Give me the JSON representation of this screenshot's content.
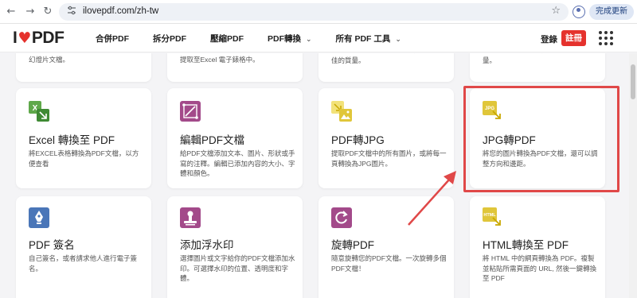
{
  "browser": {
    "url": "ilovepdf.com/zh-tw",
    "update_label": "完成更新",
    "icons": [
      "back-icon",
      "forward-icon",
      "reload-icon",
      "site-settings-icon",
      "bookmark-star-icon",
      "profile-icon"
    ]
  },
  "header": {
    "logo_left": "I",
    "logo_right": "PDF",
    "nav": [
      "合併PDF",
      "拆分PDF",
      "壓縮PDF",
      "PDF轉換",
      "所有 PDF 工具"
    ],
    "login": "登錄",
    "signup": "註冊",
    "brand_color": "#e5322d"
  },
  "cards_top": [
    "幻燈片文檔。",
    "提取至Excel 電子錶格中。",
    "DOC或DOCX文檔完全一樣，並保持最佳的質量。",
    "PPTX文檔完全一樣，並保持最佳的質量。"
  ],
  "cards": [
    {
      "title": "Excel 轉換至 PDF",
      "desc": "將EXCEL表格轉換為PDF文檔，以方便查看",
      "icon": "excel-to-pdf-icon",
      "color": "#5fa84a"
    },
    {
      "title": "編輯PDF文檔",
      "desc": "給PDF文檔添加文本、圖片、形狀或手寫的注釋。編輯已添加內容的大小、字體和顏色。",
      "icon": "edit-pdf-icon",
      "color": "#a34a8a"
    },
    {
      "title": "PDF轉JPG",
      "desc": "提取PDF文檔中的所有圖片，或將每一頁轉換為JPG圖片。",
      "icon": "pdf-to-jpg-icon",
      "color": "#e0c63a"
    },
    {
      "title": "JPG轉PDF",
      "desc": "將您的圖片轉換為PDF文檔，還可以調整方向和邊距。",
      "icon": "jpg-to-pdf-icon",
      "color": "#e0c63a"
    },
    {
      "title": "PDF 簽名",
      "desc": "自己簽名，或者請求他人進行電子簽名。",
      "icon": "sign-pdf-icon",
      "color": "#4a76b8"
    },
    {
      "title": "添加浮水印",
      "desc": "選擇圖片或文字給你的PDF文檔添加水印。可選擇水印的位置、透明度和字體。",
      "icon": "watermark-icon",
      "color": "#a34a8a"
    },
    {
      "title": "旋轉PDF",
      "desc": "隨意旋轉您的PDF文檔。一次旋轉多個PDF文檔！",
      "icon": "rotate-pdf-icon",
      "color": "#a34a8a"
    },
    {
      "title": "HTML轉換至 PDF",
      "desc": "將 HTML 中的網頁轉換為 PDF。複製並粘貼所需頁面的 URL, 然後一鍵轉換至 PDF",
      "icon": "html-to-pdf-icon",
      "color": "#e0c63a"
    }
  ],
  "icon_text": {
    "jpg": "JPG",
    "html": "HTML"
  },
  "highlight_color": "#e04848"
}
